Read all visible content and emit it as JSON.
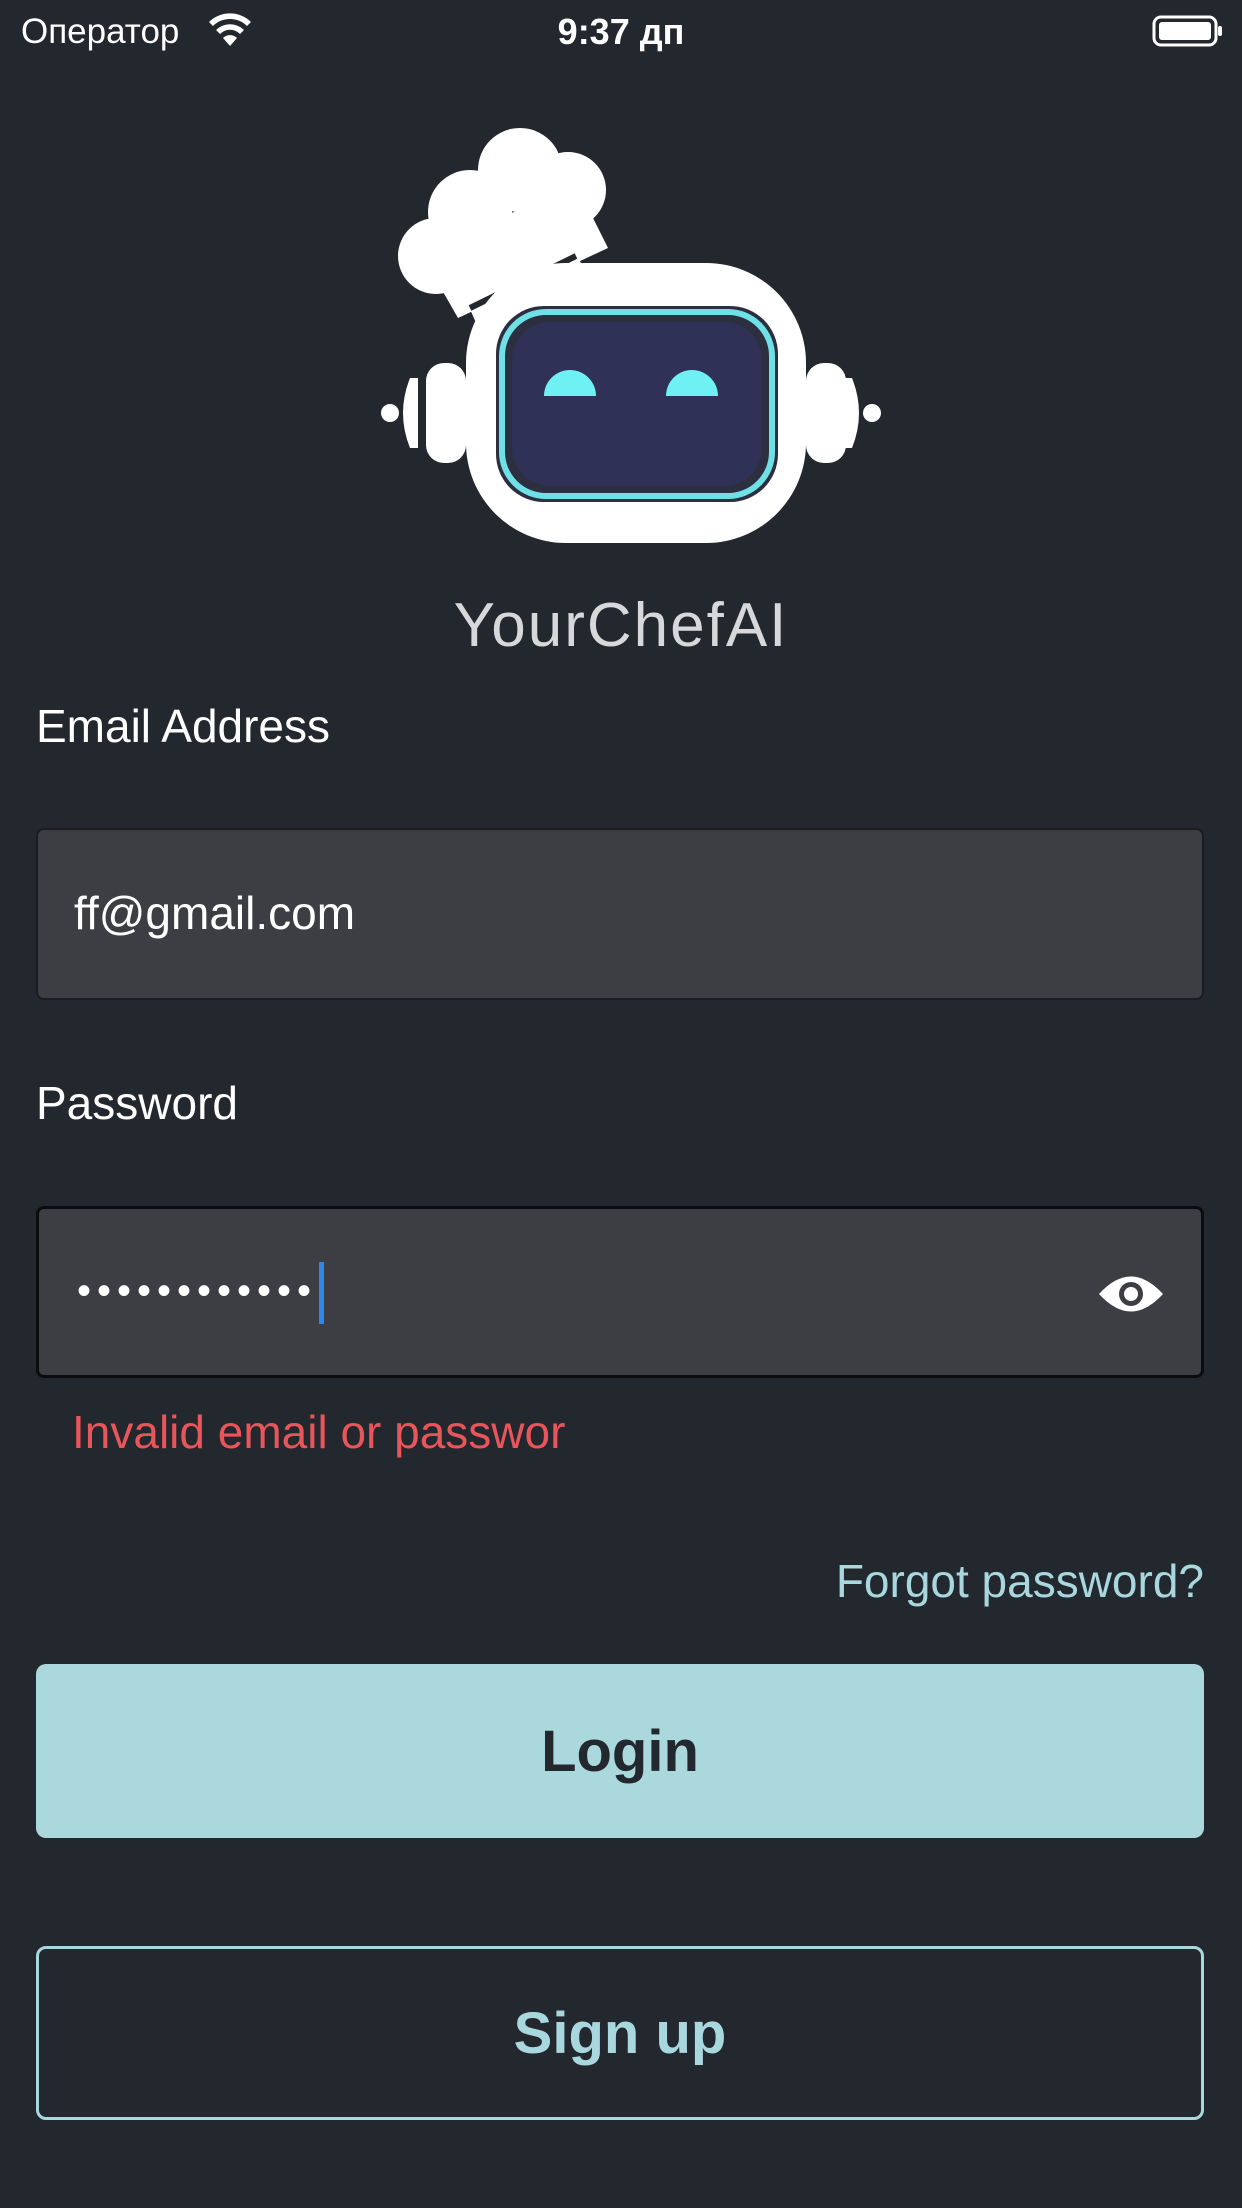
{
  "status_bar": {
    "carrier": "Оператор",
    "time": "9:37 дп",
    "wifi_icon": "wifi-icon",
    "battery_icon": "battery-icon"
  },
  "brand": {
    "logo_icon": "chef-robot-logo",
    "name": "YourChefAI"
  },
  "form": {
    "email": {
      "label": "Email Address",
      "value": "ff@gmail.com"
    },
    "password": {
      "label": "Password",
      "masked_value": "••••••••••••",
      "toggle_icon": "eye-icon"
    },
    "error": "Invalid email or passwor",
    "forgot_password": "Forgot password?",
    "login_label": "Login",
    "signup_label": "Sign up"
  },
  "colors": {
    "background": "#23272e",
    "input_background": "#3d3e44",
    "accent": "#aad8dd",
    "error": "#e8555a",
    "caret": "#2e86ef"
  }
}
